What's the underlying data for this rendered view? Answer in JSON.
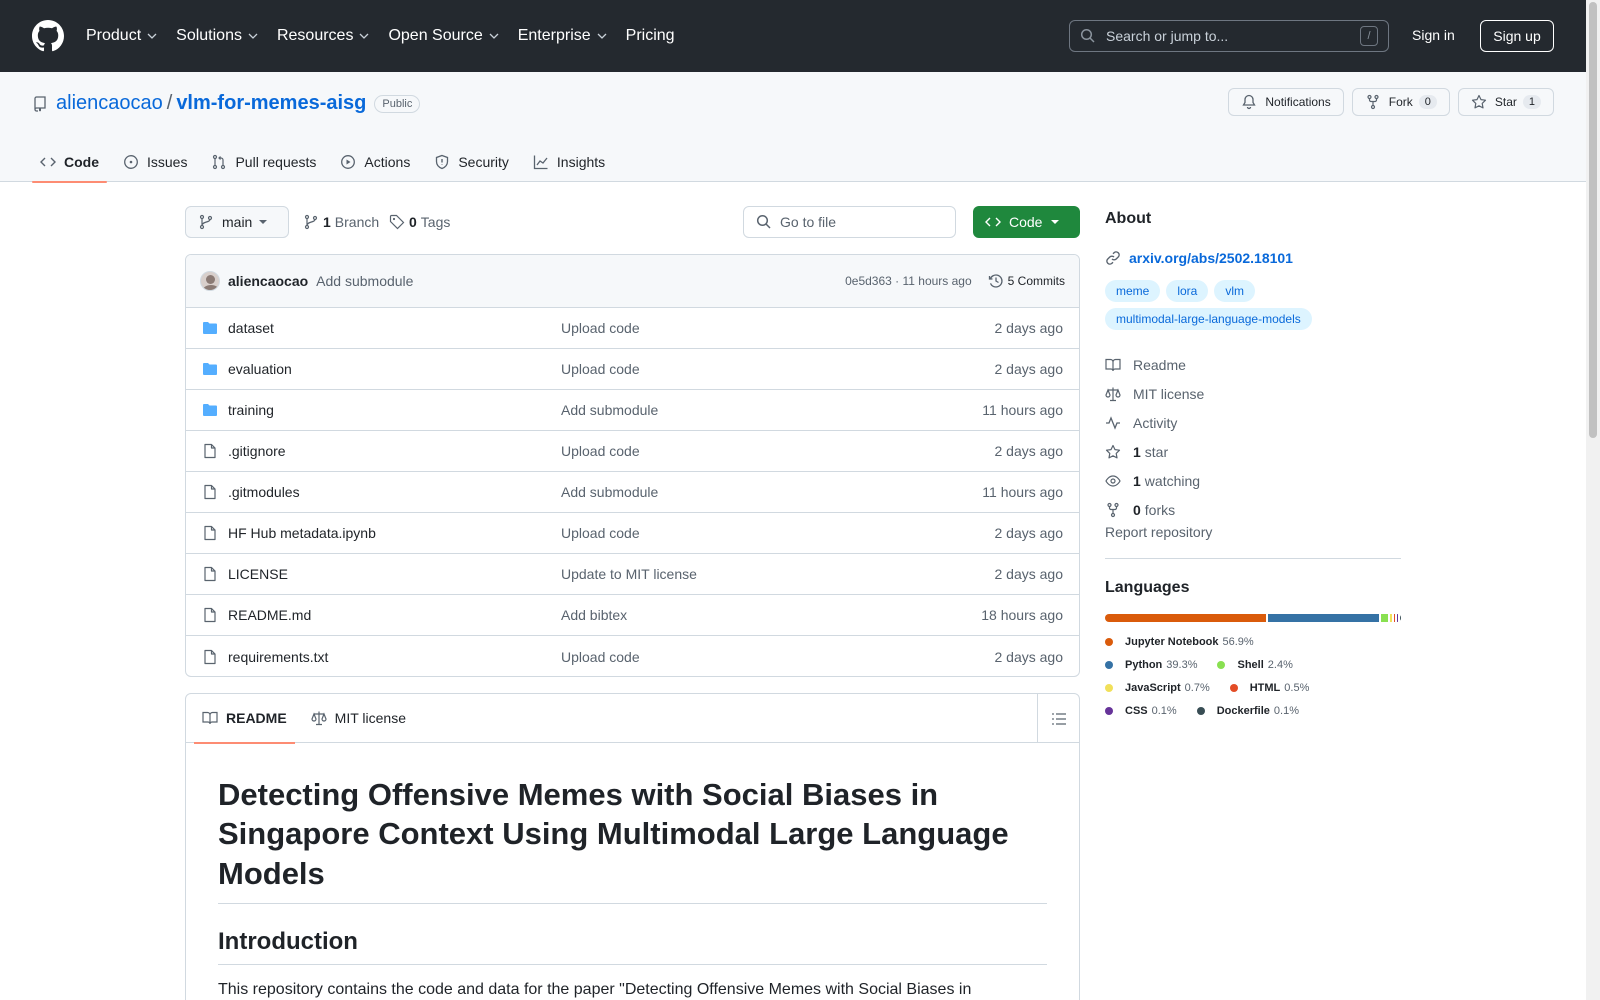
{
  "header": {
    "nav": [
      "Product",
      "Solutions",
      "Resources",
      "Open Source",
      "Enterprise",
      "Pricing"
    ],
    "search_placeholder": "Search or jump to...",
    "search_key": "/",
    "signin": "Sign in",
    "signup": "Sign up"
  },
  "repo": {
    "owner": "aliencaocao",
    "separator": "/",
    "name": "vlm-for-memes-aisg",
    "visibility": "Public",
    "notifications": "Notifications",
    "fork_label": "Fork",
    "fork_count": "0",
    "star_label": "Star",
    "star_count": "1",
    "tabs": [
      "Code",
      "Issues",
      "Pull requests",
      "Actions",
      "Security",
      "Insights"
    ]
  },
  "filebar": {
    "branch": "main",
    "branches_count": "1",
    "branches_label": "Branch",
    "tags_count": "0",
    "tags_label": "Tags",
    "goto_placeholder": "Go to file",
    "code_button": "Code"
  },
  "commit": {
    "author": "aliencaocao",
    "message": "Add submodule",
    "hash_time": "0e5d363 · 11 hours ago",
    "commits": "5 Commits"
  },
  "files": [
    {
      "type": "folder",
      "name": "dataset",
      "message": "Upload code",
      "time": "2 days ago"
    },
    {
      "type": "folder",
      "name": "evaluation",
      "message": "Upload code",
      "time": "2 days ago"
    },
    {
      "type": "folder",
      "name": "training",
      "message": "Add submodule",
      "time": "11 hours ago"
    },
    {
      "type": "file",
      "name": ".gitignore",
      "message": "Upload code",
      "time": "2 days ago"
    },
    {
      "type": "file",
      "name": ".gitmodules",
      "message": "Add submodule",
      "time": "11 hours ago"
    },
    {
      "type": "file",
      "name": "HF Hub metadata.ipynb",
      "message": "Upload code",
      "time": "2 days ago"
    },
    {
      "type": "file",
      "name": "LICENSE",
      "message": "Update to MIT license",
      "time": "2 days ago"
    },
    {
      "type": "file",
      "name": "README.md",
      "message": "Add bibtex",
      "time": "18 hours ago"
    },
    {
      "type": "file",
      "name": "requirements.txt",
      "message": "Upload code",
      "time": "2 days ago"
    }
  ],
  "readme": {
    "tab_readme": "README",
    "tab_license": "MIT license",
    "title": "Detecting Offensive Memes with Social Biases in Singapore Context Using Multimodal Large Language Models",
    "intro_heading": "Introduction",
    "intro_text": "This repository contains the code and data for the paper \"Detecting Offensive Memes with Social Biases in"
  },
  "about": {
    "title": "About",
    "link": "arxiv.org/abs/2502.18101",
    "topics": [
      "meme",
      "lora",
      "vlm",
      "multimodal-large-language-models"
    ],
    "readme": "Readme",
    "license": "MIT license",
    "activity": "Activity",
    "stars_count": "1",
    "stars_label": "star",
    "watching_count": "1",
    "watching_label": "watching",
    "forks_count": "0",
    "forks_label": "forks",
    "report": "Report repository"
  },
  "languages": {
    "title": "Languages",
    "items": [
      {
        "name": "Jupyter Notebook",
        "pct": "56.9%",
        "value": 56.9,
        "color": "#DA5B0B"
      },
      {
        "name": "Python",
        "pct": "39.3%",
        "value": 39.3,
        "color": "#3572A5"
      },
      {
        "name": "Shell",
        "pct": "2.4%",
        "value": 2.4,
        "color": "#89e051"
      },
      {
        "name": "JavaScript",
        "pct": "0.7%",
        "value": 0.7,
        "color": "#f1e05a"
      },
      {
        "name": "HTML",
        "pct": "0.5%",
        "value": 0.5,
        "color": "#e34c26"
      },
      {
        "name": "CSS",
        "pct": "0.1%",
        "value": 0.1,
        "color": "#663399"
      },
      {
        "name": "Dockerfile",
        "pct": "0.1%",
        "value": 0.1,
        "color": "#384d54"
      }
    ]
  }
}
